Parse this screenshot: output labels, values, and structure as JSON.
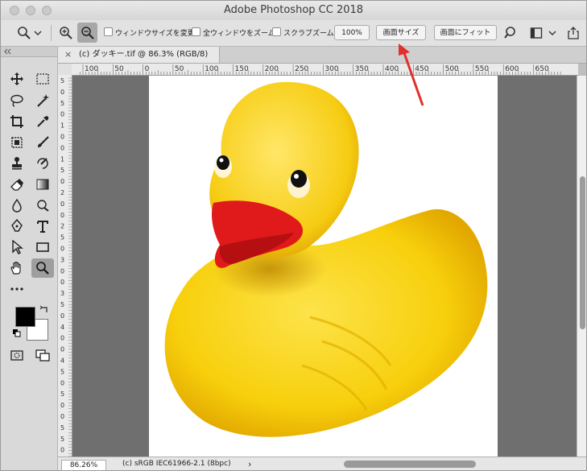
{
  "window": {
    "title": "Adobe Photoshop CC 2018"
  },
  "options_bar": {
    "resize_windows": "ウィンドウサイズを変更",
    "zoom_all_windows": "全ウィンドウをズーム",
    "scrubby_zoom": "スクラブズーム",
    "btn_100": "100%",
    "btn_screen_size": "画面サイズ",
    "btn_fit_screen": "画面にフィット"
  },
  "document": {
    "tab_label": "(c) ダッキー.tif @ 86.3% (RGB/8)",
    "close_glyph": "×"
  },
  "ruler": {
    "h_labels": [
      "100",
      "50",
      "0",
      "50",
      "100",
      "150",
      "200",
      "250",
      "300",
      "350",
      "400",
      "450",
      "500",
      "550",
      "600",
      "650"
    ],
    "v_labels": [
      "5",
      "0",
      "5",
      "0",
      "1",
      "0",
      "0",
      "1",
      "5",
      "0",
      "2",
      "0",
      "0",
      "2",
      "5",
      "0",
      "3",
      "0",
      "0",
      "3",
      "5",
      "0",
      "4",
      "0",
      "0",
      "4",
      "5",
      "0",
      "5",
      "0",
      "0",
      "5",
      "5",
      "0"
    ]
  },
  "status": {
    "zoom": "86.26%",
    "profile": "(c) sRGB IEC61966-2.1 (8bpc)",
    "arrow": "›"
  },
  "colors": {
    "accent": "#e2302b",
    "foreground": "#000000",
    "background": "#ffffff",
    "duck": "#f7cf0c"
  }
}
